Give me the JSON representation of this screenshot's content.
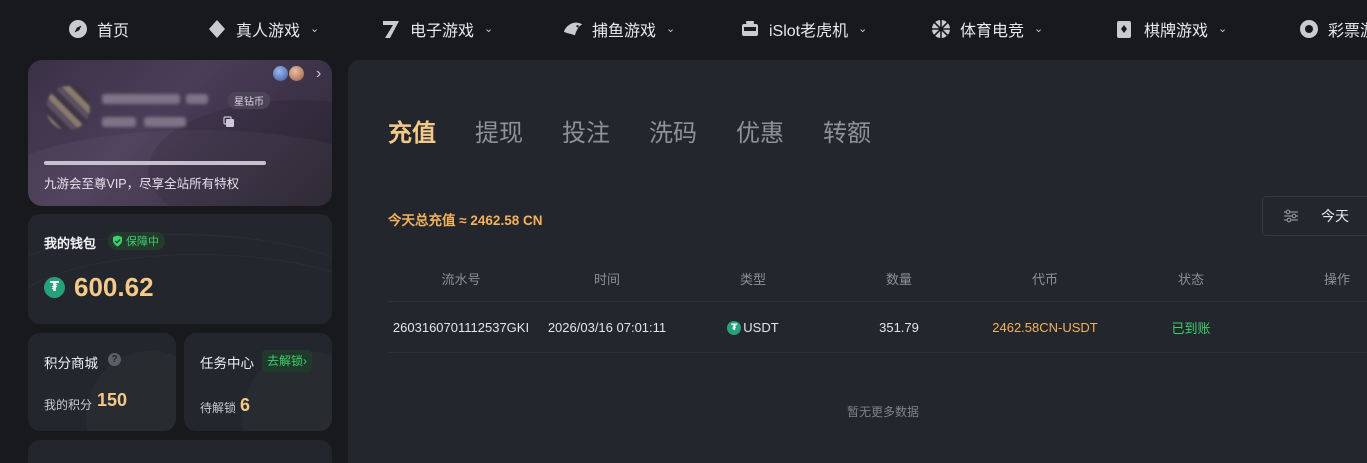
{
  "nav": {
    "items": [
      {
        "label": "首页",
        "icon": "compass-icon",
        "dropdown": false
      },
      {
        "label": "真人游戏",
        "icon": "diamond-icon",
        "dropdown": true
      },
      {
        "label": "电子游戏",
        "icon": "seven-icon",
        "dropdown": true
      },
      {
        "label": "捕鱼游戏",
        "icon": "fish-icon",
        "dropdown": true
      },
      {
        "label": "iSlot老虎机",
        "icon": "slot-machine-icon",
        "dropdown": true
      },
      {
        "label": "体育电竞",
        "icon": "ball-icon",
        "dropdown": true
      },
      {
        "label": "棋牌游戏",
        "icon": "cards-icon",
        "dropdown": true
      },
      {
        "label": "彩票游",
        "icon": "lottery-icon",
        "dropdown": false
      }
    ],
    "chevron": "⌄"
  },
  "vip": {
    "level_badge": "星钻币",
    "progress": 0.73,
    "description": "九游会至尊VIP，尽享全站所有特权",
    "arrow": "›"
  },
  "wallet": {
    "title": "我的钱包",
    "secure_badge": "保障中",
    "coin_symbol": "₮",
    "amount": "600.62"
  },
  "points": {
    "title": "积分商城",
    "help": "?",
    "label": "我的积分",
    "value": "150"
  },
  "tasks": {
    "title": "任务中心",
    "unlock_label": "去解锁›",
    "label": "待解锁",
    "value": "6"
  },
  "main": {
    "tabs": [
      "充值",
      "提现",
      "投注",
      "洗码",
      "优惠",
      "转额"
    ],
    "active_tab": 0,
    "summary": "今天总充值 ≈ 2462.58 CN",
    "filter_label": "今天",
    "columns": [
      "流水号",
      "时间",
      "类型",
      "数量",
      "代币",
      "状态",
      "操作"
    ],
    "rows": [
      {
        "serial": "2603160701112537GKI",
        "time": "2026/03/16 07:01:11",
        "type": "USDT",
        "amount": "351.79",
        "token": "2462.58CN-USDT",
        "status": "已到账",
        "action": ""
      }
    ],
    "empty_text": "暂无更多数据"
  },
  "colors": {
    "accent_gold": "#f4c98a",
    "success_green": "#3ecf6e",
    "usdt_green": "#26a17b"
  }
}
